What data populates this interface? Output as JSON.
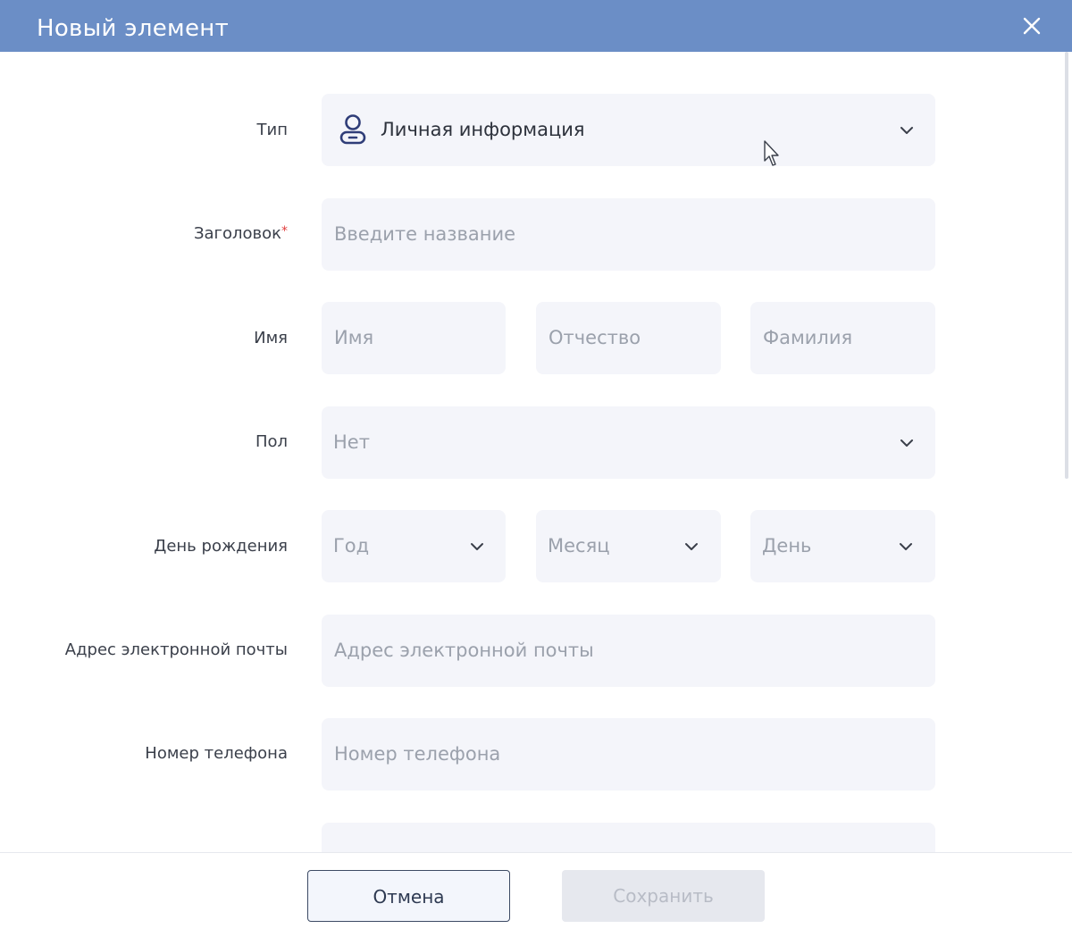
{
  "dialog": {
    "title": "Новый элемент"
  },
  "form": {
    "type": {
      "label": "Тип",
      "value": "Личная информация",
      "icon": "person-icon"
    },
    "heading": {
      "label": "Заголовок",
      "required_mark": "*",
      "placeholder": "Введите название"
    },
    "name": {
      "label": "Имя",
      "first_placeholder": "Имя",
      "middle_placeholder": "Отчество",
      "last_placeholder": "Фамилия"
    },
    "gender": {
      "label": "Пол",
      "value": "Нет"
    },
    "birthday": {
      "label": "День рождения",
      "year_placeholder": "Год",
      "month_placeholder": "Месяц",
      "day_placeholder": "День"
    },
    "email": {
      "label": "Адрес электронной почты",
      "placeholder": "Адрес электронной почты"
    },
    "phone": {
      "label": "Номер телефона",
      "placeholder": "Номер телефона"
    }
  },
  "footer": {
    "cancel_label": "Отмена",
    "save_label": "Сохранить"
  },
  "colors": {
    "header": "#6b8ec6",
    "field_bg": "#f4f5fa",
    "required": "#e03c3c",
    "cancel_border": "#3c4a64",
    "save_disabled_bg": "#e6e8ee"
  }
}
